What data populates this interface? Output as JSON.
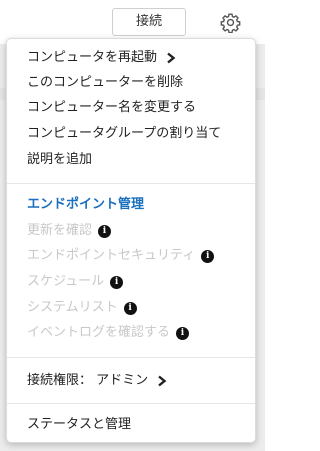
{
  "toolbar": {
    "connect_label": "接続",
    "gear_icon": "gear-icon"
  },
  "menu": {
    "group1": [
      {
        "label": "コンピュータを再起動",
        "submenu": true
      },
      {
        "label": "このコンピューターを削除"
      },
      {
        "label": "コンピューター名を変更する"
      },
      {
        "label": "コンピュータグループの割り当て"
      },
      {
        "label": "説明を追加"
      }
    ],
    "endpoint_header": "エンドポイント管理",
    "group2": [
      {
        "label": "更新を確認",
        "disabled": true,
        "info": true
      },
      {
        "label": "エンドポイントセキュリティ",
        "disabled": true,
        "info": true
      },
      {
        "label": "スケジュール",
        "disabled": true,
        "info": true
      },
      {
        "label": "システムリスト",
        "disabled": true,
        "info": true
      },
      {
        "label": "イベントログを確認する",
        "disabled": true,
        "info": true
      }
    ],
    "permission_label": "接続権限： アドミン",
    "status_label": "ステータスと管理"
  },
  "colors": {
    "header": "#1a6fbf",
    "disabled": "#c8c8c8",
    "text": "#222222"
  }
}
